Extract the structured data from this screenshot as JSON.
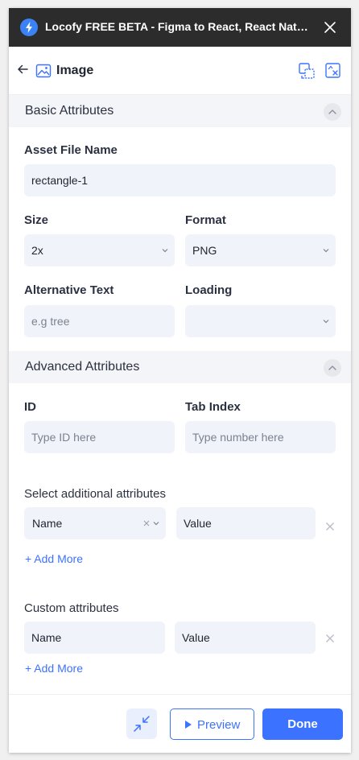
{
  "titlebar": {
    "title": "Locofy FREE BETA - Figma to React, React Nativ...",
    "close_icon": "close-icon"
  },
  "header": {
    "title": "Image"
  },
  "basic": {
    "title": "Basic Attributes",
    "asset_label": "Asset File Name",
    "asset_value": "rectangle-1",
    "size_label": "Size",
    "size_value": "2x",
    "format_label": "Format",
    "format_value": "PNG",
    "alt_label": "Alternative Text",
    "alt_placeholder": "e.g tree",
    "loading_label": "Loading",
    "loading_value": ""
  },
  "advanced": {
    "title": "Advanced Attributes",
    "id_label": "ID",
    "id_placeholder": "Type ID here",
    "tabindex_label": "Tab Index",
    "tabindex_placeholder": "Type number here",
    "additional_label": "Select additional attributes",
    "additional_name": "Name",
    "additional_value": "Value",
    "add_more": "+ Add More",
    "custom_label": "Custom attributes",
    "custom_name": "Name",
    "custom_value": "Value",
    "custom_add_more": "+ Add More"
  },
  "footer": {
    "preview_label": "Preview",
    "done_label": "Done"
  },
  "colors": {
    "accent": "#3b72ff",
    "titlebar": "#2c2c2c",
    "field": "#f0f3fa",
    "section": "#f4f5f8"
  }
}
